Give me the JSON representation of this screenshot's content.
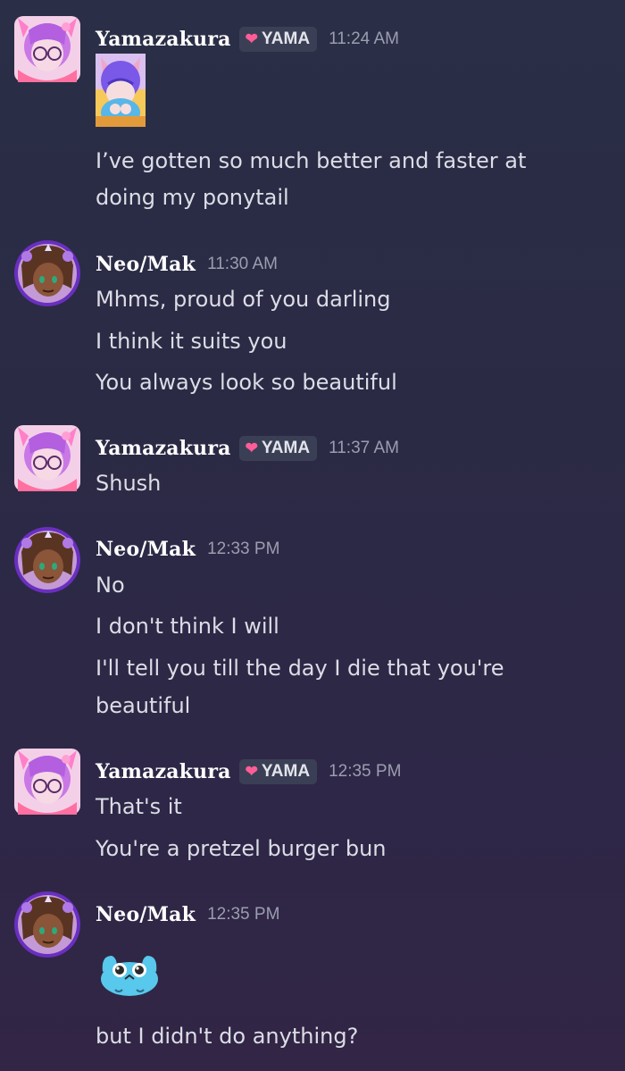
{
  "messages": [
    {
      "author": "Yamazakura",
      "tag": "YAMA",
      "time": "11:24 AM",
      "sticker": "yamazakura-sticker",
      "lines": [
        "I’ve gotten so much better and faster at",
        "doing my ponytail"
      ]
    },
    {
      "author": "Neo/Mak",
      "time": "11:30 AM",
      "lines": [
        "Mhms, proud of you darling",
        "I think it suits you",
        "You always look so beautiful"
      ]
    },
    {
      "author": "Yamazakura",
      "tag": "YAMA",
      "time": "11:37 AM",
      "lines": [
        "Shush"
      ]
    },
    {
      "author": "Neo/Mak",
      "time": "12:33 PM",
      "lines": [
        "No",
        "I don't think I will",
        "I'll tell you till the day I die that you're",
        "beautiful"
      ]
    },
    {
      "author": "Yamazakura",
      "tag": "YAMA",
      "time": "12:35 PM",
      "lines": [
        "That's it",
        "You're a pretzel burger bun"
      ]
    },
    {
      "author": "Neo/Mak",
      "time": "12:35 PM",
      "sticker": "blue-crying-emoji",
      "lines": [
        "but I didn't do anything?"
      ]
    }
  ],
  "icons": {
    "tag_icon": "heart-icon",
    "yamazakura_avatar": "pink-hair-girl-avatar",
    "neo_avatar": "brown-hair-girl-avatar"
  },
  "colors": {
    "username": "#ffffff",
    "timestamp": "#9b9db0",
    "message_text": "#dcdde6",
    "tag_background": "#3b3f55",
    "tag_heart": "#ff5d97"
  }
}
